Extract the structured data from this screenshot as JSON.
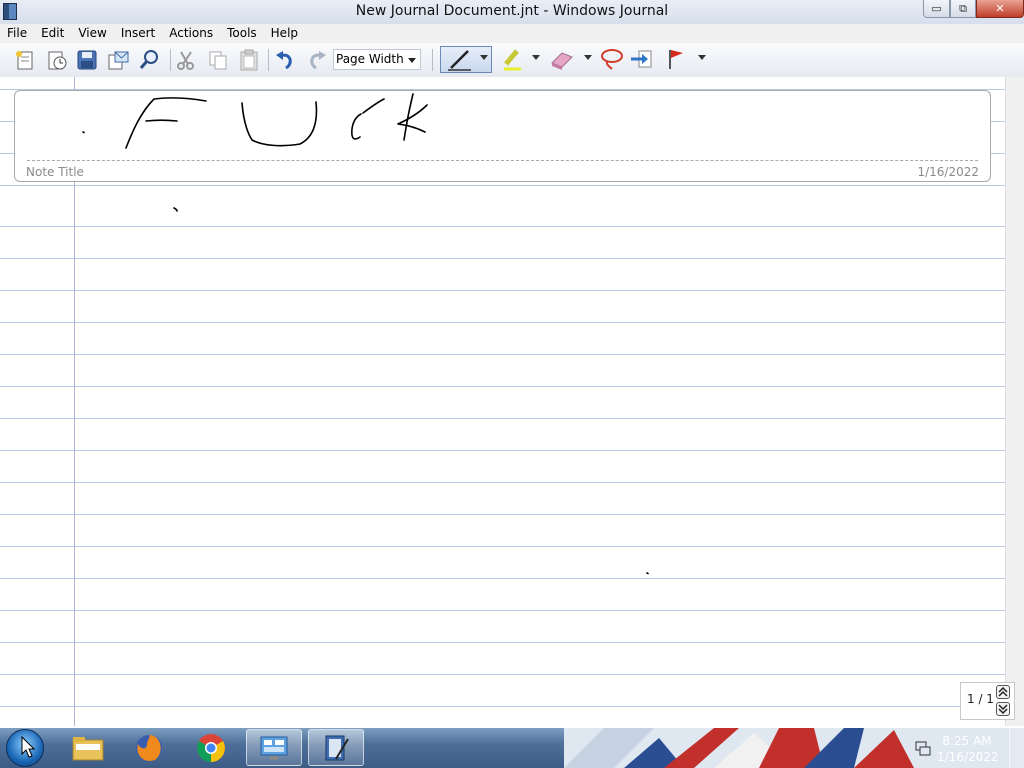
{
  "window": {
    "title": "New Journal Document.jnt - Windows Journal",
    "controls": {
      "minimize": "▭",
      "maximize": "⧉",
      "close": "✕"
    }
  },
  "menu": [
    "File",
    "Edit",
    "View",
    "Insert",
    "Actions",
    "Tools",
    "Help"
  ],
  "toolbar": {
    "zoom": "Page Width",
    "tools": [
      "new-note-icon",
      "new-from-template-icon",
      "save-icon",
      "send-email-icon",
      "find-icon",
      "cut-icon",
      "copy-icon",
      "paste-icon",
      "undo-icon",
      "redo-icon",
      "pen-icon",
      "highlighter-icon",
      "eraser-icon",
      "lasso-select-icon",
      "insert-space-icon",
      "flag-icon"
    ]
  },
  "note": {
    "title_placeholder": "Note Title",
    "date": "1/16/2022"
  },
  "page_nav": {
    "current": "1 / 1"
  },
  "taskbar": {
    "time": "8:25 AM",
    "date": "1/16/2022",
    "apps": [
      "file-explorer-icon",
      "firefox-icon",
      "chrome-icon",
      "control-panel-icon",
      "windows-journal-icon"
    ]
  },
  "colors": {
    "rule_line": "#b8c9e6",
    "margin_line": "#b7b3d6",
    "taskbar": "#4d6f99"
  }
}
